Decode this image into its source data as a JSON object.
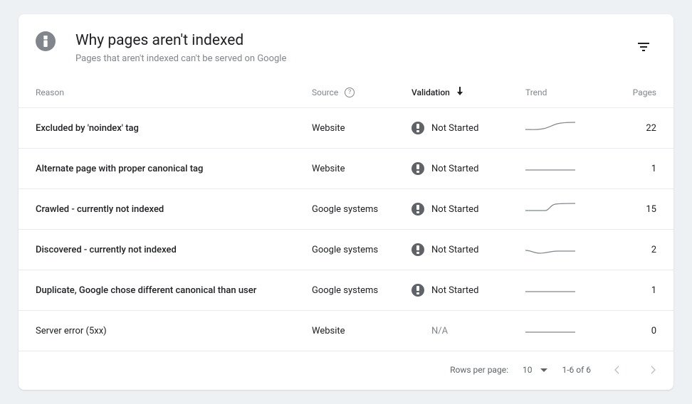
{
  "header": {
    "title": "Why pages aren't indexed",
    "subtitle": "Pages that aren't indexed can't be served on Google"
  },
  "columns": {
    "reason": "Reason",
    "source": "Source",
    "validation": "Validation",
    "trend": "Trend",
    "pages": "Pages"
  },
  "rows": [
    {
      "reason": "Excluded by 'noindex' tag",
      "source": "Website",
      "validation": "Not Started",
      "has_icon": true,
      "trend": "wave-up",
      "pages": "22"
    },
    {
      "reason": "Alternate page with proper canonical tag",
      "source": "Website",
      "validation": "Not Started",
      "has_icon": true,
      "trend": "flat",
      "pages": "1"
    },
    {
      "reason": "Crawled - currently not indexed",
      "source": "Google systems",
      "validation": "Not Started",
      "has_icon": true,
      "trend": "step-up",
      "pages": "15"
    },
    {
      "reason": "Discovered - currently not indexed",
      "source": "Google systems",
      "validation": "Not Started",
      "has_icon": true,
      "trend": "dip",
      "pages": "2"
    },
    {
      "reason": "Duplicate, Google chose different canonical than user",
      "source": "Google systems",
      "validation": "Not Started",
      "has_icon": true,
      "trend": "flat",
      "pages": "1"
    },
    {
      "reason": "Server error (5xx)",
      "source": "Website",
      "validation": "N/A",
      "has_icon": false,
      "trend": "flat",
      "pages": "0"
    }
  ],
  "pagination": {
    "rows_label": "Rows per page:",
    "rows_value": "10",
    "range": "1-6 of 6"
  }
}
